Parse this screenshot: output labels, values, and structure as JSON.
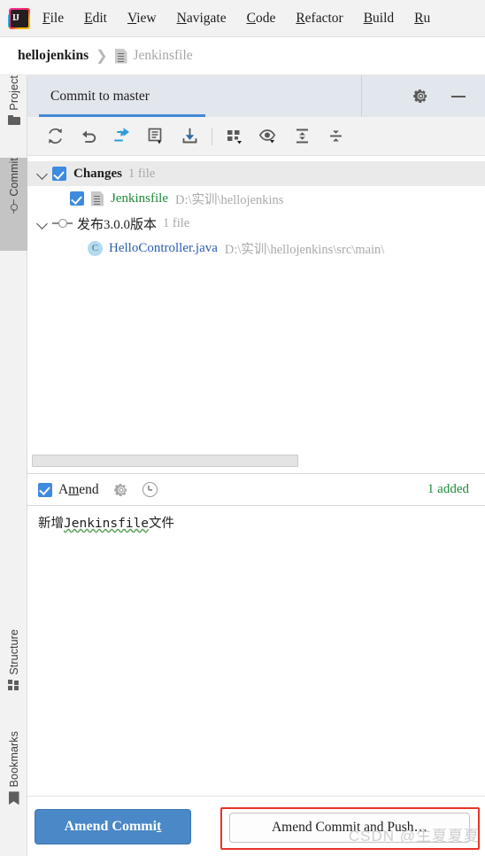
{
  "menu": {
    "logo_icon": "intellij-idea-logo",
    "items": [
      {
        "label": "File",
        "mnemonic": "F",
        "rest": "ile"
      },
      {
        "label": "Edit",
        "mnemonic": "E",
        "rest": "dit"
      },
      {
        "label": "View",
        "mnemonic": "V",
        "rest": "iew"
      },
      {
        "label": "Navigate",
        "mnemonic": "N",
        "rest": "avigate"
      },
      {
        "label": "Code",
        "mnemonic": "C",
        "rest": "ode"
      },
      {
        "label": "Refactor",
        "mnemonic": "R",
        "rest": "efactor"
      },
      {
        "label": "Build",
        "mnemonic": "B",
        "rest": "uild"
      },
      {
        "label": "Ru",
        "mnemonic": "R",
        "rest": "u"
      }
    ]
  },
  "breadcrumb": {
    "project": "hellojenkins",
    "separator": "❯",
    "file_icon": "text-file-icon",
    "file": "Jenkinsfile"
  },
  "stripe": {
    "items": [
      {
        "label": "Project",
        "icon": "folder-icon",
        "selected": false
      },
      {
        "label": "Commit",
        "icon": "commit-icon",
        "selected": true
      },
      {
        "label": "Structure",
        "icon": "structure-icon",
        "selected": false
      },
      {
        "label": "Bookmarks",
        "icon": "bookmark-icon",
        "selected": false
      }
    ]
  },
  "toolwindow": {
    "tab_label": "Commit to master",
    "settings_icon": "gear-icon",
    "minimize_icon": "minimize-icon",
    "toolbar": [
      {
        "icon": "refresh-icon",
        "name": "refresh-changes-button"
      },
      {
        "icon": "rollback-icon",
        "name": "rollback-button"
      },
      {
        "icon": "move-to-another-changelist-icon",
        "name": "move-changes-button"
      },
      {
        "icon": "show-diff-icon",
        "name": "show-diff-button"
      },
      {
        "icon": "update-project-icon",
        "name": "update-project-button"
      },
      {
        "icon": "separator",
        "name": "toolbar-separator"
      },
      {
        "icon": "group-by-icon",
        "name": "group-by-button"
      },
      {
        "icon": "preview-diff-icon",
        "name": "preview-diff-button"
      },
      {
        "icon": "expand-all-icon",
        "name": "expand-all-button"
      },
      {
        "icon": "collapse-all-icon",
        "name": "collapse-all-button"
      }
    ]
  },
  "changes_tree": {
    "rows": [
      {
        "type": "changelist",
        "expander": "chevron-down-icon",
        "checked": true,
        "label": "Changes",
        "count": "1 file",
        "selected": true
      },
      {
        "type": "file",
        "checked": true,
        "icon": "text-file-icon",
        "name": "Jenkinsfile",
        "name_color": "#1f8a3b",
        "path": "D:\\实训\\hellojenkins"
      },
      {
        "type": "changelist",
        "expander": "chevron-down-icon",
        "checked": false,
        "icon": "changelist-node-icon",
        "label": "发布3.0.0版本",
        "count": "1 file",
        "selected": false
      },
      {
        "type": "file",
        "checked": false,
        "icon": "java-class-icon",
        "icon_letter": "C",
        "name": "HelloController.java",
        "name_color": "#2a5db0",
        "path": "D:\\实训\\hellojenkins\\src\\main\\"
      }
    ]
  },
  "amend": {
    "checked": true,
    "label_mnemonic_prefix": "A",
    "label_mnemonic": "m",
    "label_suffix": "end",
    "settings_icon": "gear-icon",
    "history_icon": "clock-history-icon",
    "status": "1 added",
    "status_color": "#1f8a3b"
  },
  "commit_message": {
    "text": "新增Jenkinsfile文件",
    "prefix": "新增",
    "spellcheck_word": "Jenkinsfile",
    "suffix": "文件"
  },
  "buttons": {
    "primary_prefix": "Amend Commi",
    "primary_mnemonic": "t",
    "primary_label": "Amend Commit",
    "primary_color": "#4a88c7",
    "secondary_label": "Amend Commit and Push…",
    "highlight_color": "#e8342a"
  },
  "watermark": {
    "text": "CSDN @生夏夏夏"
  }
}
